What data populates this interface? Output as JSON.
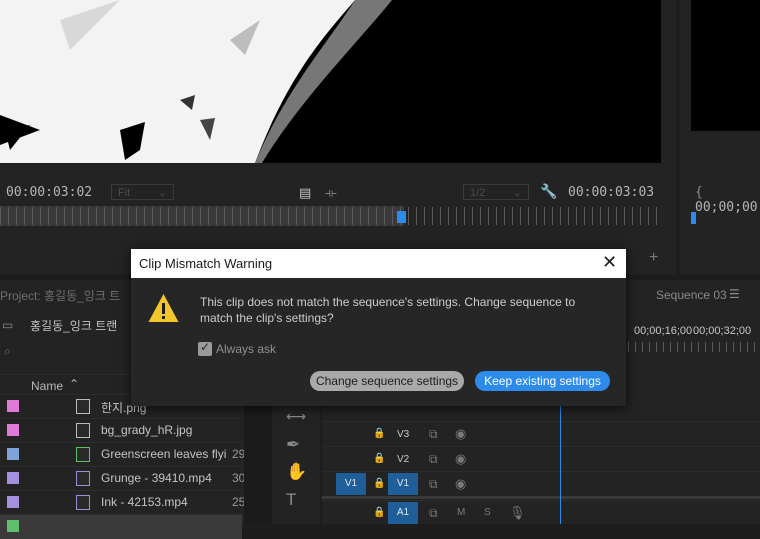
{
  "program_monitor": {
    "timecode_left": "00:00:03:02",
    "fit_dropdown": "Fit",
    "resolution_dropdown": "1/2",
    "timecode_right": "00:00:03:03"
  },
  "source_monitor": {
    "timecode": "00;00;00"
  },
  "project_panel": {
    "tab_label": "Project: 홍길동_잉크 트",
    "bin_name": "홍길동_잉크 트랜",
    "column_name": "Name",
    "items": [
      {
        "name": "한지.png",
        "color": "#e07ad8",
        "type": "image",
        "size": ""
      },
      {
        "name": "bg_grady_hR.jpg",
        "color": "#e07ad8",
        "type": "image",
        "size": ""
      },
      {
        "name": "Greenscreen leaves flyi",
        "color": "#7ea3d8",
        "type": "video-green",
        "size": "29"
      },
      {
        "name": "Grunge - 39410.mp4",
        "color": "#a58fe0",
        "type": "video",
        "size": "30"
      },
      {
        "name": "Ink - 42153.mp4",
        "color": "#a58fe0",
        "type": "video",
        "size": "25"
      }
    ]
  },
  "timeline": {
    "tab_label": "Sequence 03",
    "ruler_marks": [
      "00;00;16;00",
      "00;00;32;00"
    ],
    "tracks": [
      {
        "name": "V3"
      },
      {
        "name": "V2"
      },
      {
        "name": "V1",
        "source": "V1"
      },
      {
        "name": "A1",
        "mute": "M",
        "solo": "S"
      }
    ]
  },
  "dialog": {
    "title": "Clip Mismatch Warning",
    "message": "This clip does not match the sequence's settings. Change sequence to match the clip's settings?",
    "checkbox_label": "Always ask",
    "checkbox_checked": true,
    "change_button": "Change sequence settings",
    "keep_button": "Keep existing settings",
    "accent_color": "#2d8ceb"
  }
}
